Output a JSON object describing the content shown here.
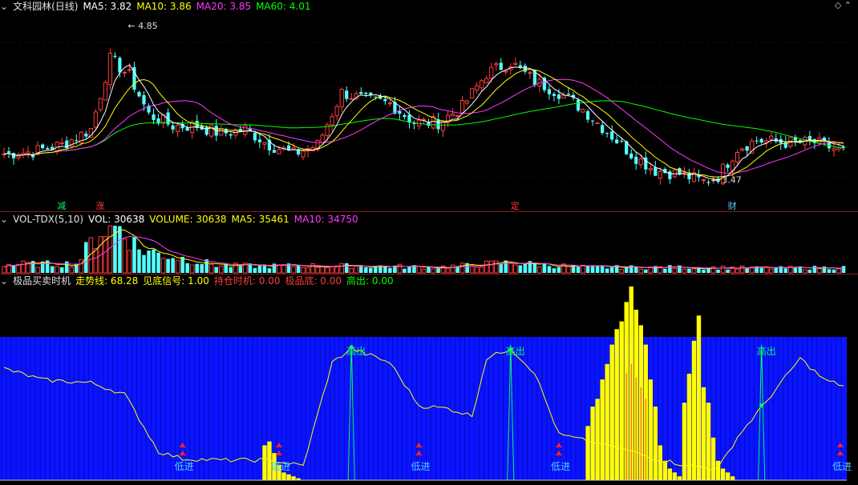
{
  "colors": {
    "up": "#ff3c3c",
    "down": "#54ffff",
    "ma5": "#ffffff",
    "ma10": "#ffff00",
    "ma20": "#ff38ff",
    "ma60": "#00ff00",
    "separator": "#8a1a1a",
    "blue_bg": "#0a14ff",
    "bottom_yellow": "#ffff00",
    "bottom_line": "#ffff00",
    "signal_green": "#00ff66",
    "arrow_red": "#ff2020",
    "label_text": "#4fd0ff"
  },
  "price_panel": {
    "title": "文科园林(日线)",
    "ma5_label": "MA5: 3.82",
    "ma10_label": "MA10: 3.86",
    "ma20_label": "MA20: 3.85",
    "ma60_label": "MA60: 4.01",
    "high_label": "4.85",
    "low_label": "3.47",
    "event_labels": [
      {
        "text": "减",
        "index": 12,
        "color": "#00ff66"
      },
      {
        "text": "涨",
        "index": 20,
        "color": "#ff3c3c"
      },
      {
        "text": "定",
        "index": 106,
        "color": "#ff3c3c"
      },
      {
        "text": "财",
        "index": 151,
        "color": "#4fd0ff"
      }
    ]
  },
  "volume_panel": {
    "title": "VOL-TDX(5,10)",
    "vol_label": "VOL: 30638",
    "volume_label": "VOLUME: 30638",
    "ma5_label": "MA5: 35461",
    "ma10_label": "MA10: 34750"
  },
  "indicator_panel": {
    "title": "极品买卖时机",
    "trend_label": "走势线: 68.28",
    "bottom_label": "见底信号: 1.00",
    "hold_label": "持仓时机: 0.00",
    "extreme_label": "极品底: 0.00",
    "high_label": "高出: 0.00",
    "buy_text": "低进",
    "sell_text": "高出",
    "buy_signal_index": [
      37,
      57,
      86,
      115,
      174
    ],
    "sell_signal_index": [
      72,
      105,
      157
    ]
  },
  "chart_data": {
    "type": "candlestick",
    "count": 175,
    "price_range": [
      3.3,
      4.95
    ],
    "candles_seed_trend": [
      [
        0,
        3.7
      ],
      [
        6,
        3.72
      ],
      [
        12,
        3.78
      ],
      [
        18,
        3.92
      ],
      [
        22,
        4.55
      ],
      [
        26,
        4.4
      ],
      [
        30,
        4.05
      ],
      [
        35,
        3.95
      ],
      [
        40,
        3.95
      ],
      [
        45,
        3.88
      ],
      [
        50,
        3.92
      ],
      [
        55,
        3.78
      ],
      [
        60,
        3.7
      ],
      [
        65,
        3.78
      ],
      [
        70,
        4.25
      ],
      [
        75,
        4.18
      ],
      [
        80,
        4.15
      ],
      [
        85,
        3.98
      ],
      [
        90,
        3.98
      ],
      [
        95,
        4.12
      ],
      [
        100,
        4.42
      ],
      [
        105,
        4.52
      ],
      [
        110,
        4.35
      ],
      [
        115,
        4.25
      ],
      [
        120,
        4.1
      ],
      [
        125,
        3.9
      ],
      [
        130,
        3.7
      ],
      [
        135,
        3.55
      ],
      [
        140,
        3.52
      ],
      [
        145,
        3.45
      ],
      [
        148,
        3.5
      ],
      [
        152,
        3.75
      ],
      [
        156,
        3.82
      ],
      [
        162,
        3.8
      ],
      [
        168,
        3.8
      ],
      [
        174,
        3.72
      ]
    ],
    "volume_seed_trend": [
      [
        0,
        0.18
      ],
      [
        15,
        0.2
      ],
      [
        20,
        0.9
      ],
      [
        24,
        1.0
      ],
      [
        28,
        0.5
      ],
      [
        35,
        0.35
      ],
      [
        45,
        0.15
      ],
      [
        60,
        0.15
      ],
      [
        75,
        0.15
      ],
      [
        90,
        0.12
      ],
      [
        105,
        0.22
      ],
      [
        120,
        0.12
      ],
      [
        140,
        0.12
      ],
      [
        160,
        0.1
      ],
      [
        174,
        0.12
      ]
    ],
    "indicator_line_seed": [
      [
        0,
        78
      ],
      [
        8,
        70
      ],
      [
        18,
        68
      ],
      [
        25,
        60
      ],
      [
        32,
        20
      ],
      [
        37,
        15
      ],
      [
        45,
        14
      ],
      [
        50,
        14
      ],
      [
        55,
        14
      ],
      [
        62,
        10
      ],
      [
        68,
        82
      ],
      [
        72,
        92
      ],
      [
        80,
        82
      ],
      [
        86,
        52
      ],
      [
        92,
        50
      ],
      [
        97,
        45
      ],
      [
        100,
        85
      ],
      [
        105,
        92
      ],
      [
        110,
        75
      ],
      [
        115,
        32
      ],
      [
        120,
        28
      ],
      [
        128,
        22
      ],
      [
        135,
        15
      ],
      [
        142,
        10
      ],
      [
        148,
        8
      ],
      [
        152,
        30
      ],
      [
        158,
        55
      ],
      [
        165,
        85
      ],
      [
        170,
        70
      ],
      [
        174,
        66
      ]
    ],
    "yellow_bar_seed": [
      [
        54,
        18
      ],
      [
        55,
        20
      ],
      [
        56,
        14
      ],
      [
        57,
        8
      ],
      [
        58,
        4
      ],
      [
        59,
        3
      ],
      [
        60,
        2
      ],
      [
        61,
        1
      ],
      [
        121,
        28
      ],
      [
        122,
        38
      ],
      [
        123,
        42
      ],
      [
        124,
        52
      ],
      [
        125,
        60
      ],
      [
        126,
        70
      ],
      [
        127,
        78
      ],
      [
        128,
        82
      ],
      [
        129,
        92
      ],
      [
        130,
        100
      ],
      [
        131,
        88
      ],
      [
        132,
        80
      ],
      [
        133,
        70
      ],
      [
        134,
        52
      ],
      [
        135,
        38
      ],
      [
        136,
        18
      ],
      [
        137,
        10
      ],
      [
        138,
        6
      ],
      [
        139,
        4
      ],
      [
        140,
        2
      ],
      [
        141,
        40
      ],
      [
        142,
        55
      ],
      [
        143,
        72
      ],
      [
        144,
        85
      ],
      [
        145,
        48
      ],
      [
        146,
        40
      ],
      [
        147,
        22
      ],
      [
        148,
        10
      ],
      [
        149,
        6
      ],
      [
        150,
        4
      ],
      [
        151,
        2
      ]
    ],
    "ylim": [
      0,
      100
    ]
  }
}
